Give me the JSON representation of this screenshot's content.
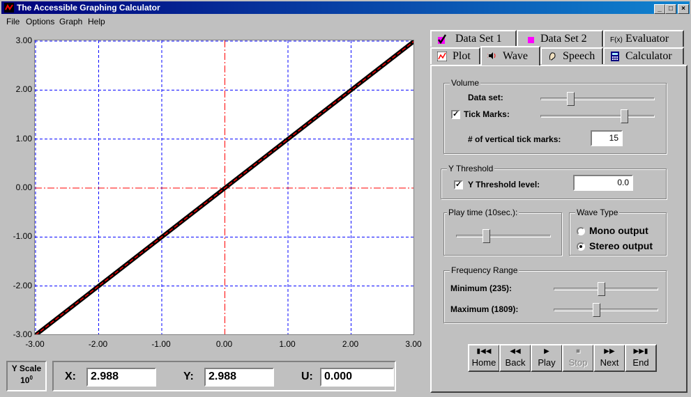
{
  "window": {
    "title": "The Accessible Graphing Calculator",
    "min": "_",
    "max": "□",
    "close": "×"
  },
  "menu": {
    "file": "File",
    "options": "Options",
    "graph": "Graph",
    "help": "Help"
  },
  "chart_data": {
    "type": "line",
    "x": [
      -3.0,
      3.0
    ],
    "series": [
      {
        "values": [
          -3.0,
          3.0
        ]
      }
    ],
    "xlim": [
      -3.0,
      3.0
    ],
    "ylim": [
      -3.0,
      3.0
    ],
    "xticks": [
      "-3.00",
      "-2.00",
      "-1.00",
      "0.00",
      "1.00",
      "2.00",
      "3.00"
    ],
    "yticks": [
      "3.00",
      "2.00",
      "1.00",
      "0.00",
      "-1.00",
      "-2.00",
      "-3.00"
    ],
    "grid": true,
    "colors": {
      "line": "#000000",
      "overlay": "#ff0000",
      "grid": "#0000ff",
      "axis": "#ff0000"
    }
  },
  "readout": {
    "yscale_label": "Y Scale",
    "yscale_base": "10",
    "yscale_exp": "0",
    "x_label": "X:",
    "x_value": "2.988",
    "y_label": "Y:",
    "y_value": "2.988",
    "u_label": "U:",
    "u_value": "0.000"
  },
  "tabs": {
    "data_set_1": "Data Set 1",
    "data_set_2": "Data Set 2",
    "evaluator": "Evaluator",
    "evaluator_icon": "F(x)",
    "plot": "Plot",
    "wave": "Wave",
    "speech": "Speech",
    "calculator": "Calculator"
  },
  "volume": {
    "title": "Volume",
    "data_set_label": "Data set:",
    "data_set_level": 0.25,
    "tick_marks_label": "Tick Marks:",
    "tick_marks_checked": true,
    "tick_marks_level": 0.75,
    "vertical_ticks_label": "# of vertical tick marks:",
    "vertical_ticks_value": "15"
  },
  "threshold": {
    "title": "Y Threshold",
    "label": "Y Threshold level:",
    "checked": true,
    "value": "0.0"
  },
  "play_time": {
    "title": "Play time (10sec.):",
    "level": 0.3
  },
  "wave_type": {
    "title": "Wave Type",
    "mono": "Mono output",
    "stereo": "Stereo output",
    "selected": "stereo"
  },
  "frequency": {
    "title": "Frequency Range",
    "min_label": "Minimum (235):",
    "min_level": 0.45,
    "max_label": "Maximum (1809):",
    "max_level": 0.4
  },
  "nav": {
    "home": "Home",
    "back": "Back",
    "play": "Play",
    "stop": "Stop",
    "next": "Next",
    "end": "End"
  }
}
